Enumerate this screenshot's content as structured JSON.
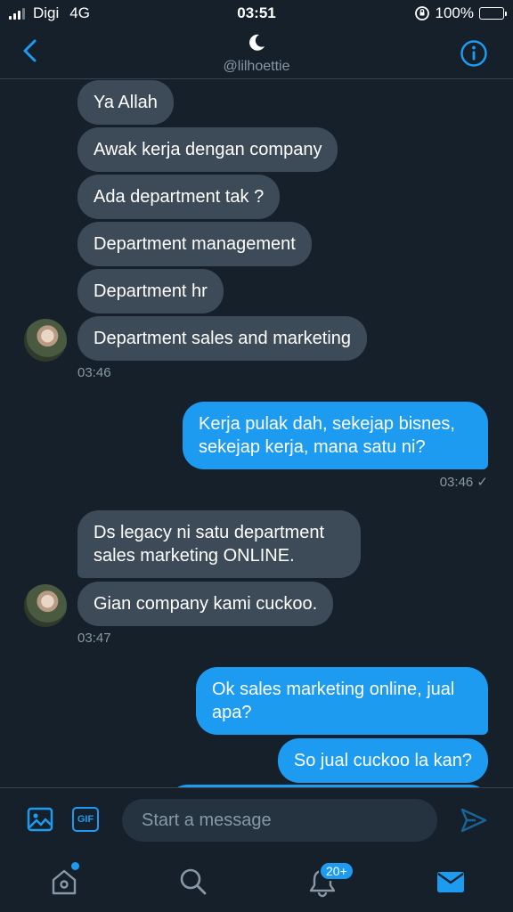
{
  "status_bar": {
    "carrier": "Digi",
    "network": "4G",
    "time": "03:51",
    "battery_percent": "100%",
    "battery_level": 1.0
  },
  "header": {
    "handle": "@lilhoettie",
    "avatar_icon": "moon-icon"
  },
  "messages": [
    {
      "side": "in",
      "text": "Ya Allah"
    },
    {
      "side": "in",
      "text": "Awak kerja dengan company"
    },
    {
      "side": "in",
      "text": "Ada department tak ?"
    },
    {
      "side": "in",
      "text": "Department management"
    },
    {
      "side": "in",
      "text": "Department hr"
    },
    {
      "side": "in",
      "text": "Department sales and marketing"
    },
    {
      "side": "in",
      "text": "Ds legacy ni satu department sales marketing ONLINE."
    },
    {
      "side": "in",
      "text": "Gian company kami cuckoo."
    },
    {
      "side": "out",
      "text": "Kerja pulak dah, sekejap bisnes, sekejap kerja, mana satu ni?"
    },
    {
      "side": "out",
      "text": "Ok sales marketing online, jual apa?"
    },
    {
      "side": "out",
      "text": "So jual cuckoo la kan?"
    }
  ],
  "timestamps": {
    "group1": "03:46",
    "out1": "03:46 ✓",
    "group2": "03:47"
  },
  "composer": {
    "placeholder": "Start a message",
    "gif_label": "GIF"
  },
  "tabbar": {
    "notifications_badge": "20+"
  },
  "colors": {
    "background": "#15202b",
    "incoming_bubble": "#3d4b58",
    "outgoing_bubble": "#1d9bf0",
    "accent": "#1d9bf0",
    "muted_text": "#8899a6"
  }
}
